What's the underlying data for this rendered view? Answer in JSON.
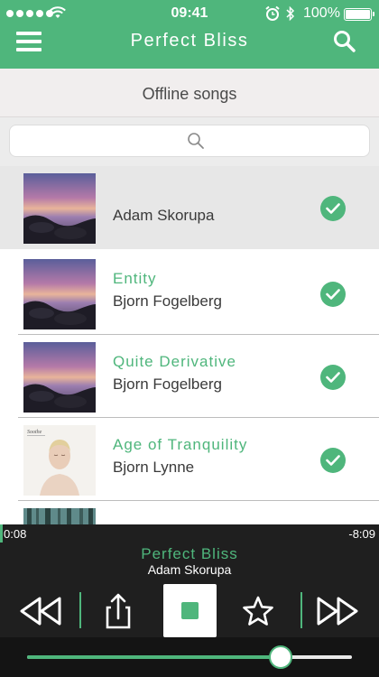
{
  "status_bar": {
    "time": "09:41",
    "battery": "100%",
    "icons": [
      "signal-dots-icon",
      "wifi-icon",
      "alarm-icon",
      "bluetooth-icon",
      "battery-icon"
    ]
  },
  "header": {
    "title": "Perfect Bliss",
    "menu_icon": "hamburger-icon",
    "search_icon": "search-icon"
  },
  "section": {
    "title": "Offline songs",
    "search_placeholder": ""
  },
  "songs": [
    {
      "title": "",
      "artist": "Adam Skorupa",
      "downloaded": true,
      "art": "sunset-rocks-art",
      "selected": true
    },
    {
      "title": "Entity",
      "artist": "Bjorn Fogelberg",
      "downloaded": true,
      "art": "sunset-rocks-art",
      "selected": false
    },
    {
      "title": "Quite Derivative",
      "artist": "Bjorn Fogelberg",
      "downloaded": true,
      "art": "sunset-rocks-art",
      "selected": false
    },
    {
      "title": "Age of Tranquility",
      "artist": "Bjorn Lynne",
      "downloaded": true,
      "art": "portrait-art",
      "art_text": "Soothe",
      "selected": false
    },
    {
      "title": "",
      "artist": "",
      "downloaded": false,
      "art": "forest-art",
      "selected": false
    }
  ],
  "player": {
    "elapsed": "0:08",
    "remaining": "-8:09",
    "track_title": "Perfect Bliss",
    "track_artist": "Adam Skorupa",
    "progress": 0.016,
    "volume": 0.78,
    "controls": [
      "rewind-icon",
      "share-icon",
      "stop-icon",
      "star-icon",
      "fast-forward-icon"
    ]
  },
  "colors": {
    "accent": "#4fb67c",
    "player_bg": "#1f1f1f",
    "selected_row": "#e7e7e7"
  }
}
